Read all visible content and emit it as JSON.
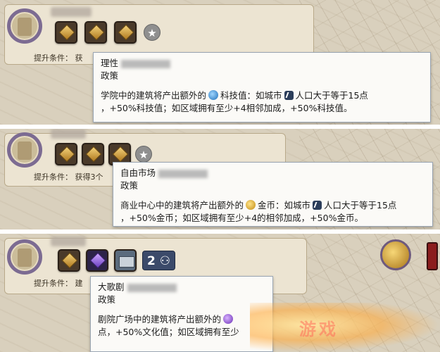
{
  "panels": [
    {
      "condition_label": "提升条件：",
      "condition_partial": "获",
      "tooltip": {
        "title": "理性",
        "subtitle": "政策",
        "line1_pre": "学院中的建筑将产出额外的",
        "line1_icon": "science-icon",
        "line1_mid": "科技值：如城市",
        "line1_icon2": "population-icon",
        "line1_post": "人口大于等于15点",
        "line2": "，+50%科技值；如区域拥有至少+4相邻加成，+50%科技值。"
      }
    },
    {
      "condition_label": "提升条件：",
      "condition_partial": "获得3个",
      "tooltip": {
        "title": "自由市场",
        "subtitle": "政策",
        "line1_pre": "商业中心中的建筑将产出额外的",
        "line1_icon": "gold-icon",
        "line1_mid": "金币：如城市",
        "line1_icon2": "population-icon",
        "line1_post": "人口大于等于15点",
        "line2": "，+50%金币；如区域拥有至少+4的相邻加成，+50%金币。"
      }
    },
    {
      "condition_label": "提升条件：",
      "condition_partial": "建",
      "badge": "2",
      "tooltip": {
        "title": "大歌剧",
        "subtitle": "政策",
        "line1_pre": "剧院广场中的建筑将产出额外的",
        "line1_icon": "culture-icon",
        "line2": "点，+50%文化值；如区域拥有至少"
      }
    }
  ],
  "watermark": "游戏"
}
